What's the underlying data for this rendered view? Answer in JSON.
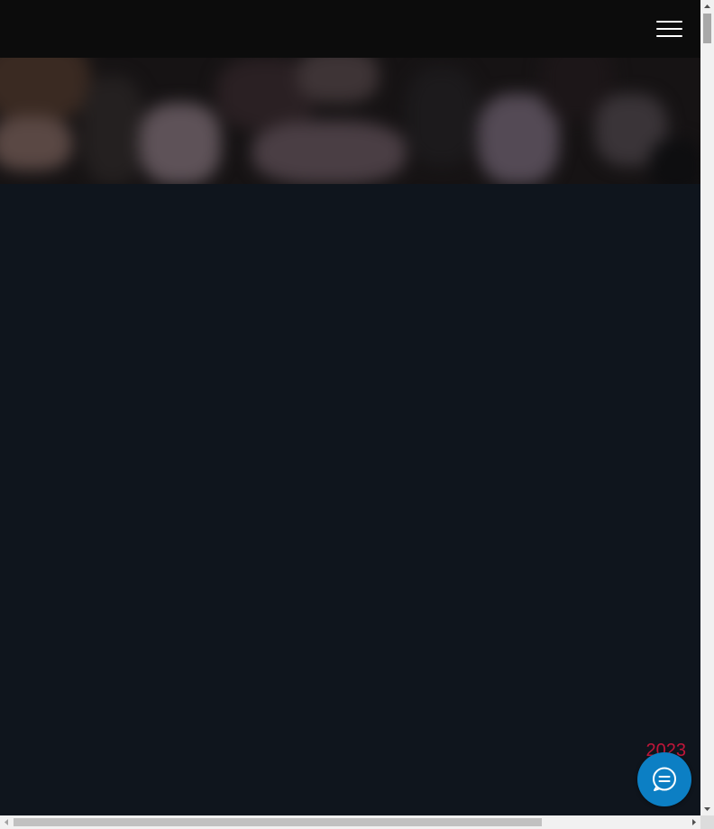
{
  "header": {
    "menu_icon": "hamburger-menu-icon"
  },
  "content": {
    "year": "2023"
  },
  "chat": {
    "icon": "chat-bubble-icon"
  },
  "colors": {
    "page_background": "#0f151d",
    "header_background": "#0c0c0c",
    "year_text": "#c0163a",
    "chat_button": "#0c7fc4"
  },
  "scrollbars": {
    "vertical_position": 0.0,
    "horizontal_position": 0.0
  }
}
